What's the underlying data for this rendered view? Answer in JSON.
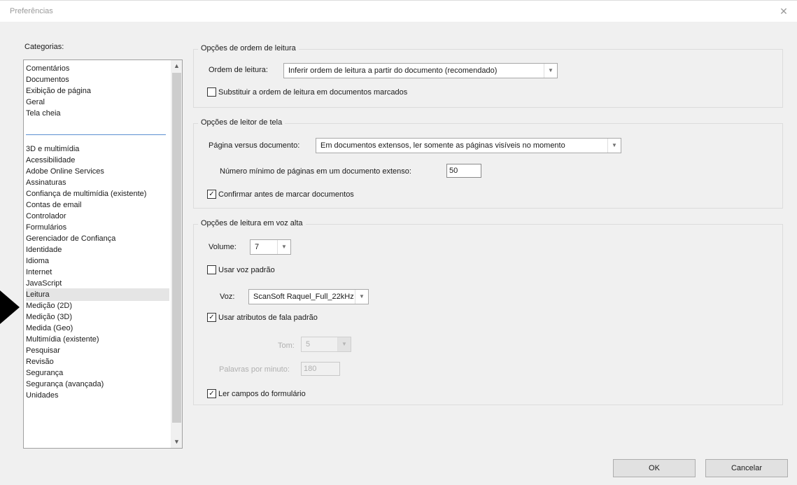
{
  "window": {
    "title": "Preferências"
  },
  "categories": {
    "label": "Categorias:",
    "top_items": [
      "Comentários",
      "Documentos",
      "Exibição de página",
      "Geral",
      "Tela cheia"
    ],
    "items": [
      "3D e multimídia",
      "Acessibilidade",
      "Adobe Online Services",
      "Assinaturas",
      "Confiança de multimídia (existente)",
      "Contas de email",
      "Controlador",
      "Formulários",
      "Gerenciador de Confiança",
      "Identidade",
      "Idioma",
      "Internet",
      "JavaScript",
      "Leitura",
      "Medição (2D)",
      "Medição (3D)",
      "Medida (Geo)",
      "Multimídia (existente)",
      "Pesquisar",
      "Revisão",
      "Segurança",
      "Segurança (avançada)",
      "Unidades"
    ],
    "selected": "Leitura"
  },
  "reading_order": {
    "title": "Opções de ordem de leitura",
    "order_label": "Ordem de leitura:",
    "order_value": "Inferir ordem de leitura a partir do documento (recomendado)",
    "override_label": "Substituir a ordem de leitura em documentos marcados",
    "override_checked": false
  },
  "screen_reader": {
    "title": "Opções de leitor de tela",
    "page_vs_doc_label": "Página versus documento:",
    "page_vs_doc_value": "Em documentos extensos, ler somente as páginas visíveis no momento",
    "min_pages_label": "Número mínimo de páginas em um documento extenso:",
    "min_pages_value": "50",
    "confirm_label": "Confirmar antes de marcar documentos",
    "confirm_checked": true
  },
  "read_aloud": {
    "title": "Opções de leitura em voz alta",
    "volume_label": "Volume:",
    "volume_value": "7",
    "default_voice_label": "Usar voz padrão",
    "default_voice_checked": false,
    "voice_label": "Voz:",
    "voice_value": "ScanSoft Raquel_Full_22kHz",
    "default_speech_label": "Usar atributos de fala padrão",
    "default_speech_checked": true,
    "tone_label": "Tom:",
    "tone_value": "5",
    "wpm_label": "Palavras por minuto:",
    "wpm_value": "180",
    "read_fields_label": "Ler campos do formulário",
    "read_fields_checked": true
  },
  "buttons": {
    "ok": "OK",
    "cancel": "Cancelar"
  }
}
